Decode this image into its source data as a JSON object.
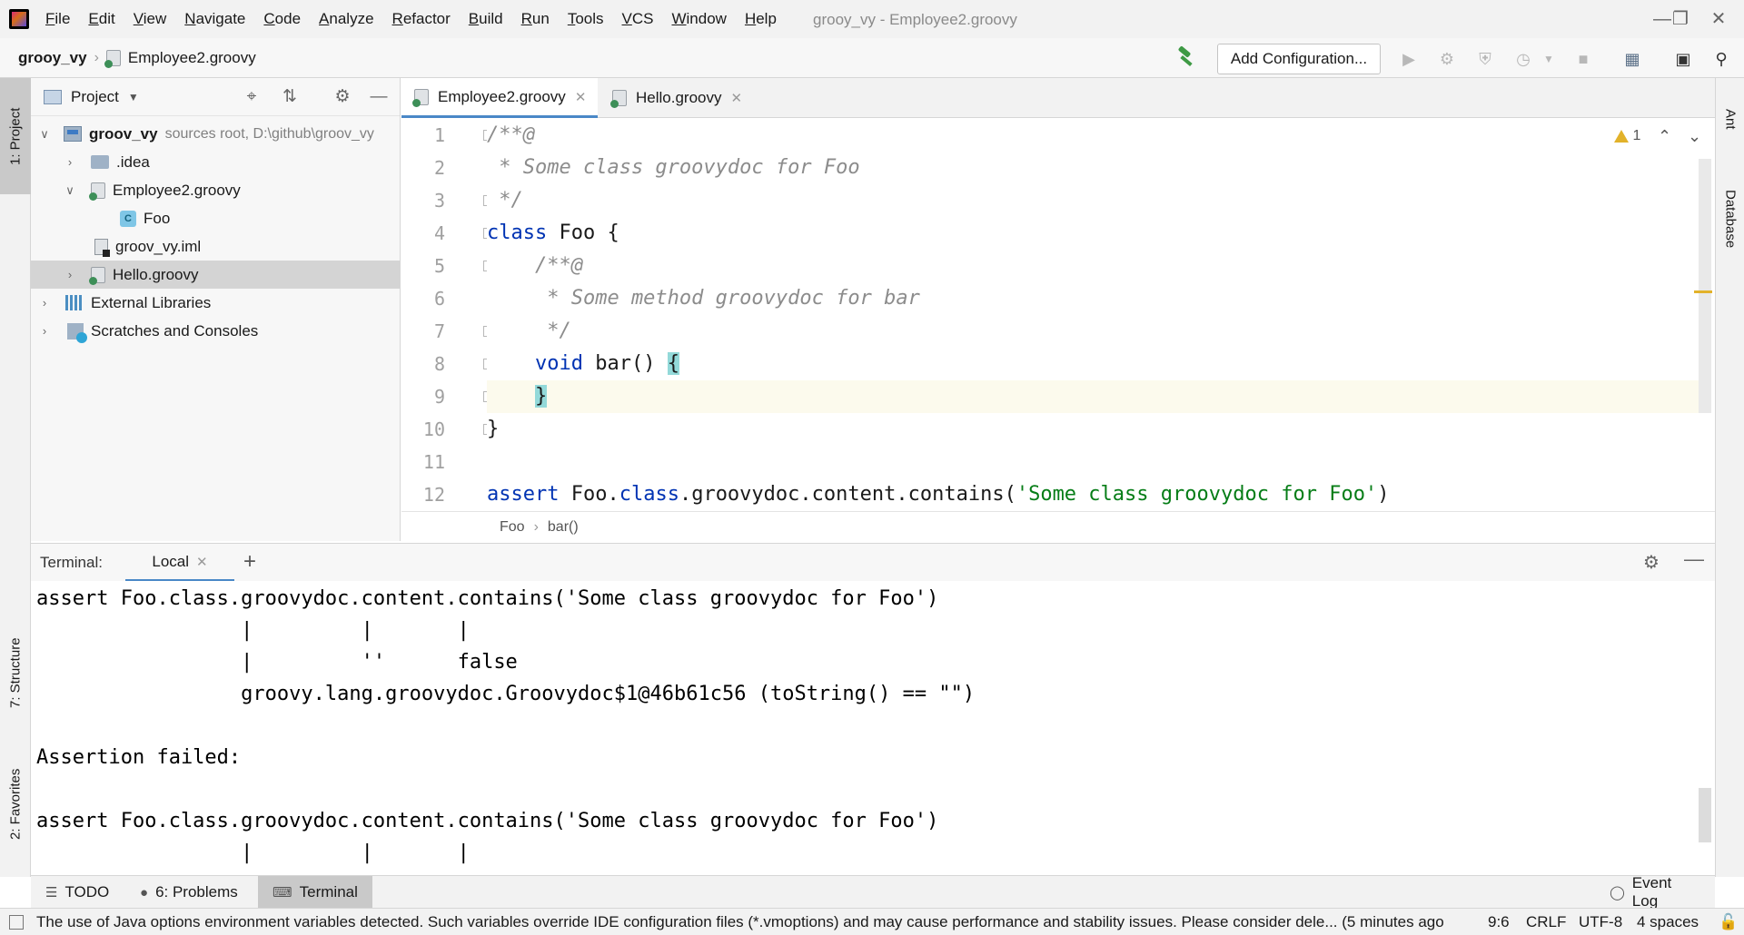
{
  "window": {
    "title": "grooy_vy - Employee2.groovy"
  },
  "menu": [
    "File",
    "Edit",
    "View",
    "Navigate",
    "Code",
    "Analyze",
    "Refactor",
    "Build",
    "Run",
    "Tools",
    "VCS",
    "Window",
    "Help"
  ],
  "navbar": {
    "project": "grooy_vy",
    "file": "Employee2.groovy",
    "add_configuration": "Add Configuration..."
  },
  "left_stripe": {
    "project": "1: Project",
    "structure": "7: Structure",
    "favorites": "2: Favorites"
  },
  "right_stripe": {
    "ant": "Ant",
    "database": "Database"
  },
  "project_panel": {
    "title": "Project",
    "tree": [
      {
        "label": "groov_vy",
        "sub": "sources root,  D:\\github\\groov_vy"
      },
      {
        "label": ".idea"
      },
      {
        "label": "Employee2.groovy"
      },
      {
        "label": "Foo"
      },
      {
        "label": "groov_vy.iml"
      },
      {
        "label": "Hello.groovy"
      },
      {
        "label": "External Libraries"
      },
      {
        "label": "Scratches and Consoles"
      }
    ]
  },
  "editor": {
    "tabs": [
      {
        "label": "Employee2.groovy",
        "active": true
      },
      {
        "label": "Hello.groovy",
        "active": false
      }
    ],
    "line_numbers": [
      "1",
      "2",
      "3",
      "4",
      "5",
      "6",
      "7",
      "8",
      "9",
      "10",
      "11",
      "12"
    ],
    "code": {
      "l1": "/**@",
      "l2": " * Some class groovydoc for Foo",
      "l3": " */",
      "l4_kw": "class",
      "l4_rest": " Foo {",
      "l5": "    /**@",
      "l6": "     * Some method groovydoc for bar",
      "l7": "     */",
      "l8_indent": "    ",
      "l8_kw": "void",
      "l8_rest": " bar() ",
      "l8_brace": "{",
      "l9_indent": "    ",
      "l9_brace": "}",
      "l10": "}",
      "l11": "",
      "l12_kw": "assert",
      "l12_a": " Foo.",
      "l12_kw2": "class",
      "l12_b": ".groovydoc.content.contains(",
      "l12_str": "'Some class groovydoc for Foo'",
      "l12_c": ")"
    },
    "warning_count": "1",
    "breadcrumbs": [
      "Foo",
      "bar()"
    ]
  },
  "terminal": {
    "title": "Terminal:",
    "tab": "Local",
    "lines": [
      "assert Foo.class.groovydoc.content.contains('Some class groovydoc for Foo')",
      "                 |         |       |",
      "                 |         ''      false",
      "                 groovy.lang.groovydoc.Groovydoc$1@46b61c56 (toString() == \"\")",
      "",
      "Assertion failed:",
      "",
      "assert Foo.class.groovydoc.content.contains('Some class groovydoc for Foo')",
      "                 |         |       |"
    ]
  },
  "tool_bar": {
    "todo": "TODO",
    "problems": "6: Problems",
    "terminal": "Terminal",
    "event_log": "Event Log"
  },
  "status_bar": {
    "message": "The use of Java options environment variables detected. Such variables override IDE configuration files (*.vmoptions) and may cause performance and stability issues. Please consider dele... (5 minutes ago",
    "position": "9:6",
    "line_sep": "CRLF",
    "encoding": "UTF-8",
    "indent": "4 spaces"
  }
}
